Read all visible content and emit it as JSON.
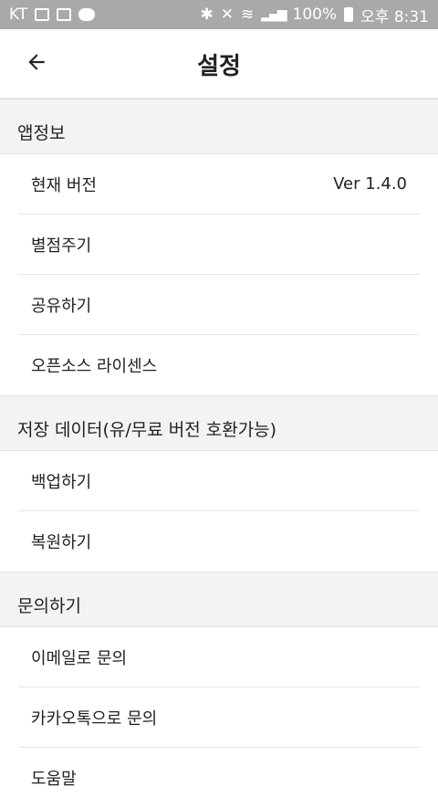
{
  "status_bar": {
    "carrier": "KT",
    "battery": "100%",
    "time": "오후 8:31"
  },
  "header": {
    "title": "설정",
    "back_icon": "arrow-left"
  },
  "sections": {
    "app_info": {
      "title": "앱정보",
      "items": [
        {
          "label": "현재 버전",
          "value": "Ver 1.4.0"
        },
        {
          "label": "별점주기"
        },
        {
          "label": "공유하기"
        },
        {
          "label": "오픈소스 라이센스"
        }
      ]
    },
    "storage": {
      "title": "저장 데이터(유/무료 버전 호환가능)",
      "items": [
        {
          "label": "백업하기"
        },
        {
          "label": "복원하기"
        }
      ]
    },
    "inquiry": {
      "title": "문의하기",
      "items": [
        {
          "label": "이메일로 문의"
        },
        {
          "label": "카카오톡으로 문의"
        },
        {
          "label": "도움말"
        }
      ]
    }
  }
}
